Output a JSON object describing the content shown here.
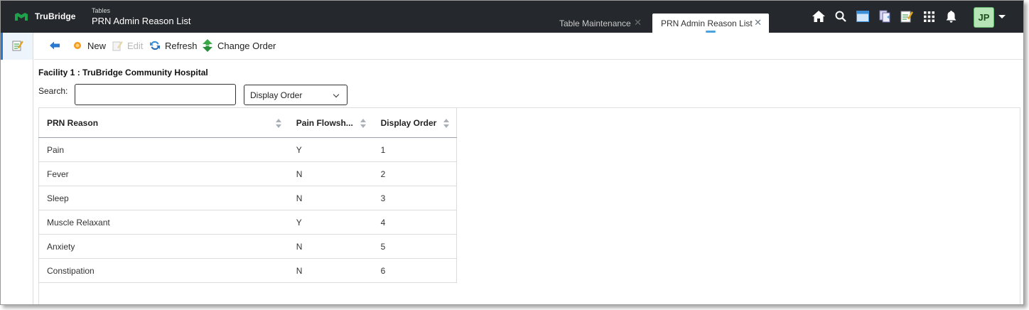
{
  "app": {
    "brand": "TruBridge",
    "breadcrumb_small": "Tables",
    "page_title": "PRN Admin Reason List"
  },
  "tabs": [
    {
      "label": "Table Maintenance",
      "active": false
    },
    {
      "label": "PRN Admin Reason List",
      "active": true
    }
  ],
  "top_icons": [
    "home-icon",
    "search-icon",
    "window-icon",
    "documents-icon",
    "notes-icon",
    "apps-grid-icon",
    "bell-icon"
  ],
  "user": {
    "initials": "JP",
    "avatar_color": "#b7e4b6"
  },
  "toolbar": {
    "new_label": "New",
    "edit_label": "Edit",
    "refresh_label": "Refresh",
    "change_order_label": "Change Order"
  },
  "facility": "Facility 1 : TruBridge Community Hospital",
  "search": {
    "label": "Search:",
    "value": "",
    "placeholder": ""
  },
  "sort_select": {
    "selected": "Display Order"
  },
  "table": {
    "columns": [
      "PRN Reason",
      "Pain Flowsh...",
      "Display Order"
    ],
    "rows": [
      [
        "Pain",
        "Y",
        "1"
      ],
      [
        "Fever",
        "N",
        "2"
      ],
      [
        "Sleep",
        "N",
        "3"
      ],
      [
        "Muscle Relaxant",
        "Y",
        "4"
      ],
      [
        "Anxiety",
        "N",
        "5"
      ],
      [
        "Constipation",
        "N",
        "6"
      ]
    ]
  },
  "colors": {
    "topbar": "#25282c",
    "brand_green": "#1fa04a",
    "accent_blue": "#2a78d0"
  }
}
